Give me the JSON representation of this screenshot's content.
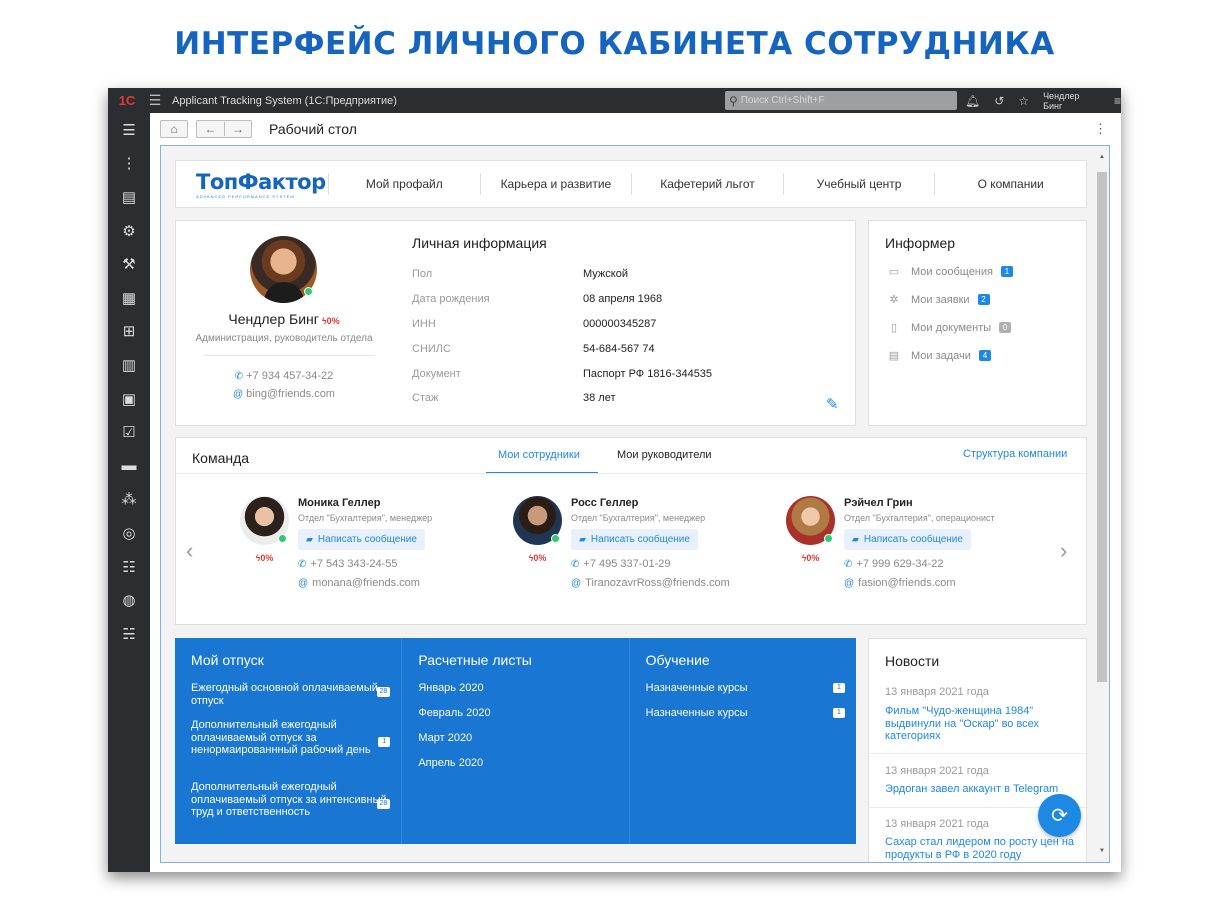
{
  "heading": "ИНТЕРФЕЙС ЛИЧНОГО КАБИНЕТА СОТРУДНИКА",
  "titlebar": {
    "logo": "1С",
    "app_title": "Applicant Tracking System  (1С:Предприятие)",
    "search_placeholder": "Поиск Ctrl+Shift+F",
    "user": "Чендлер Бинг"
  },
  "toolbar": {
    "title": "Рабочий стол"
  },
  "brand": {
    "name": "ТопФактор",
    "tagline": "ADVANCED PERFORMANCE SYSTEM"
  },
  "nav": [
    "Мой профайл",
    "Карьера и развитие",
    "Кафетерий льгот",
    "Учебный центр",
    "О компании"
  ],
  "profile": {
    "name": "Чендлер Бинг",
    "pct": "0%",
    "role": "Администрация, руководитель отдела",
    "phone": "+7 934 457-34-22",
    "email": "bing@friends.com"
  },
  "personal": {
    "title": "Личная информация",
    "rows": [
      {
        "k": "Пол",
        "v": "Мужской"
      },
      {
        "k": "Дата рождения",
        "v": "08 апреля 1968"
      },
      {
        "k": "ИНН",
        "v": "000000345287"
      },
      {
        "k": "СНИЛС",
        "v": "54-684-567 74"
      },
      {
        "k": "Документ",
        "v": "Паспорт РФ 1816-344535"
      },
      {
        "k": "Стаж",
        "v": "38 лет"
      }
    ]
  },
  "informer": {
    "title": "Информер",
    "items": [
      {
        "label": "Мои сообщения",
        "count": "1",
        "icon": "message-icon"
      },
      {
        "label": "Мои заявки",
        "count": "2",
        "icon": "request-icon"
      },
      {
        "label": "Мои документы",
        "count": "0",
        "icon": "document-icon"
      },
      {
        "label": "Мои задачи",
        "count": "4",
        "icon": "task-icon"
      }
    ]
  },
  "team": {
    "title": "Команда",
    "tab_active": "Мои сотрудники",
    "tab_other": "Мои руководители",
    "structure_link": "Структура компании",
    "message_label": "Написать сообщение",
    "members": [
      {
        "name": "Моника Геллер",
        "dept": "Отдел \"Бухгалтерия\", менеджер",
        "pct": "0%",
        "phone": "+7 543 343-24-55",
        "email": "monana@friends.com"
      },
      {
        "name": "Росс Геллер",
        "dept": "Отдел \"Бухгалтерия\", менеджер",
        "pct": "0%",
        "phone": "+7 495 337-01-29",
        "email": "TiranozavrRoss@friends.com"
      },
      {
        "name": "Рэйчел Грин",
        "dept": "Отдел \"Бухгалтерия\", операционист",
        "pct": "0%",
        "phone": "+7 999 629-34-22",
        "email": "fasion@friends.com"
      }
    ]
  },
  "vacation": {
    "title": "Мой отпуск",
    "items": [
      {
        "label": "Ежегодный основной оплачиваемый отпуск",
        "count": "28"
      },
      {
        "label": "Дополнительный ежегодный оплачиваемый отпуск за ненормаированнный рабочий день",
        "count": "1"
      },
      {
        "label": "Дополнительный ежегодный оплачиваемый отпуск за интенсивный труд и ответственность",
        "count": "28"
      }
    ]
  },
  "payslips": {
    "title": "Расчетные листы",
    "items": [
      "Январь 2020",
      "Февраль 2020",
      "Март 2020",
      "Апрель 2020"
    ]
  },
  "training": {
    "title": "Обучение",
    "items": [
      {
        "label": "Назначенные курсы",
        "count": "1"
      },
      {
        "label": "Назначенные курсы",
        "count": "1"
      }
    ]
  },
  "news": {
    "title": "Новости",
    "items": [
      {
        "date": "13 января 2021 года",
        "text": "Фильм \"Чудо-женщина 1984\" выдвинули на \"Оскар\" во всех категориях"
      },
      {
        "date": "13 января 2021 года",
        "text": "Эрдоган завел аккаунт в Telegram"
      },
      {
        "date": "13 января 2021 года",
        "text": "Сахар стал лидером по росту цен на продукты в РФ в 2020 году"
      }
    ]
  },
  "colors": {
    "accent": "#1e88e5",
    "heading": "#1565c0",
    "panel": "#1976d2",
    "sidebar": "#2b2d31",
    "pct": "#e53935"
  }
}
